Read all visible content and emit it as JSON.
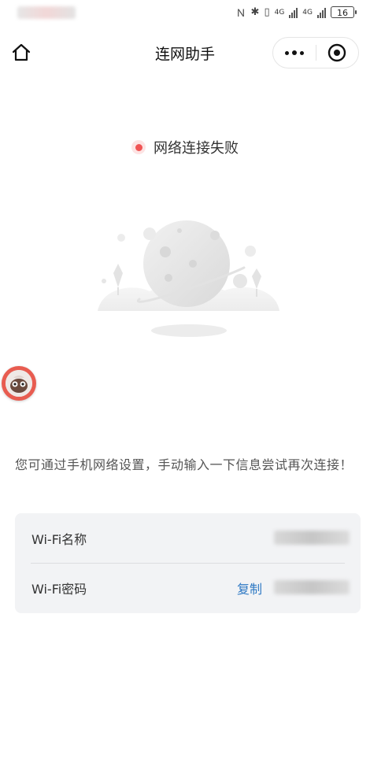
{
  "header": {
    "title": "连网助手"
  },
  "status": {
    "message": "网络连接失败"
  },
  "hint": {
    "text": "您可通过手机网络设置，手动输入一下信息尝试再次连接！"
  },
  "wifi": {
    "name_label": "Wi-Fi名称",
    "password_label": "Wi-Fi密码",
    "copy_label": "复制"
  },
  "statusbar": {
    "battery": "16",
    "network_1": "4G",
    "network_2": "4G"
  },
  "colors": {
    "error": "#f05454",
    "link": "#2f79c4",
    "card_bg": "#f2f3f5"
  },
  "icons": [
    "home-icon",
    "more-icon",
    "close-target-icon",
    "planet-illustration"
  ]
}
